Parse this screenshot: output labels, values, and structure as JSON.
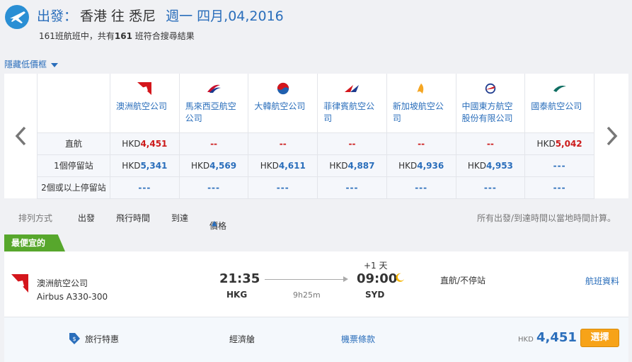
{
  "header": {
    "prefix": "出發：",
    "route": "香港 往 悉尼",
    "date": "週一 四月,04,2016",
    "flights_count": "161",
    "summary_a": "班航班中，共有",
    "summary_b": "161",
    "summary_c": " 班符合搜尋結果"
  },
  "hide_prices_label": "隱藏低價框",
  "matrix": {
    "row_labels": [
      "直航",
      "1個停留站",
      "2個或以上停留站"
    ],
    "airlines": [
      {
        "name": "澳洲航空公司",
        "icon": "qantas-logo-icon"
      },
      {
        "name": "馬來西亞航空公司",
        "icon": "malaysia-airlines-logo-icon"
      },
      {
        "name": "大韓航空公司",
        "icon": "korean-air-logo-icon"
      },
      {
        "name": "菲律賓航空公司",
        "icon": "philippine-airlines-logo-icon"
      },
      {
        "name": "新加坡航空公司",
        "icon": "singapore-airlines-logo-icon"
      },
      {
        "name": "中國東方航空股份有限公司",
        "icon": "china-eastern-logo-icon"
      },
      {
        "name": "國泰航空公司",
        "icon": "cathay-pacific-logo-icon"
      }
    ],
    "currency": "HKD",
    "direct": [
      "4,451",
      "--",
      "--",
      "--",
      "--",
      "--",
      "5,042"
    ],
    "one_stop": [
      "5,341",
      "4,569",
      "4,611",
      "4,887",
      "4,936",
      "4,953",
      "---"
    ],
    "two_plus": [
      "---",
      "---",
      "---",
      "---",
      "---",
      "---",
      "---"
    ]
  },
  "sort": {
    "label": "排列方式",
    "options": [
      "出發",
      "飛行時間",
      "到達",
      "價格"
    ],
    "note": "所有出發/到達時間以當地時間計算。"
  },
  "result": {
    "badge": "最便宜的",
    "airline": "澳洲航空公司",
    "aircraft": "Airbus A330-300",
    "dep_time": "21:35",
    "dep_code": "HKG",
    "day_offset": "+1 天",
    "arr_time": "09:00",
    "arr_code": "SYD",
    "duration": "9h25m",
    "stops": "直航/不停站",
    "details_link": "航班資料",
    "promo": "旅行特惠",
    "cabin": "經濟艙",
    "fare_rules": "機票條款",
    "currency": "HKD",
    "price": "4,451",
    "select": "選擇"
  },
  "colors": {
    "accent_blue": "#2a6ebb",
    "price_red": "#cc1a1a",
    "badge_green": "#57a72c",
    "select_orange": "#f7a318"
  }
}
